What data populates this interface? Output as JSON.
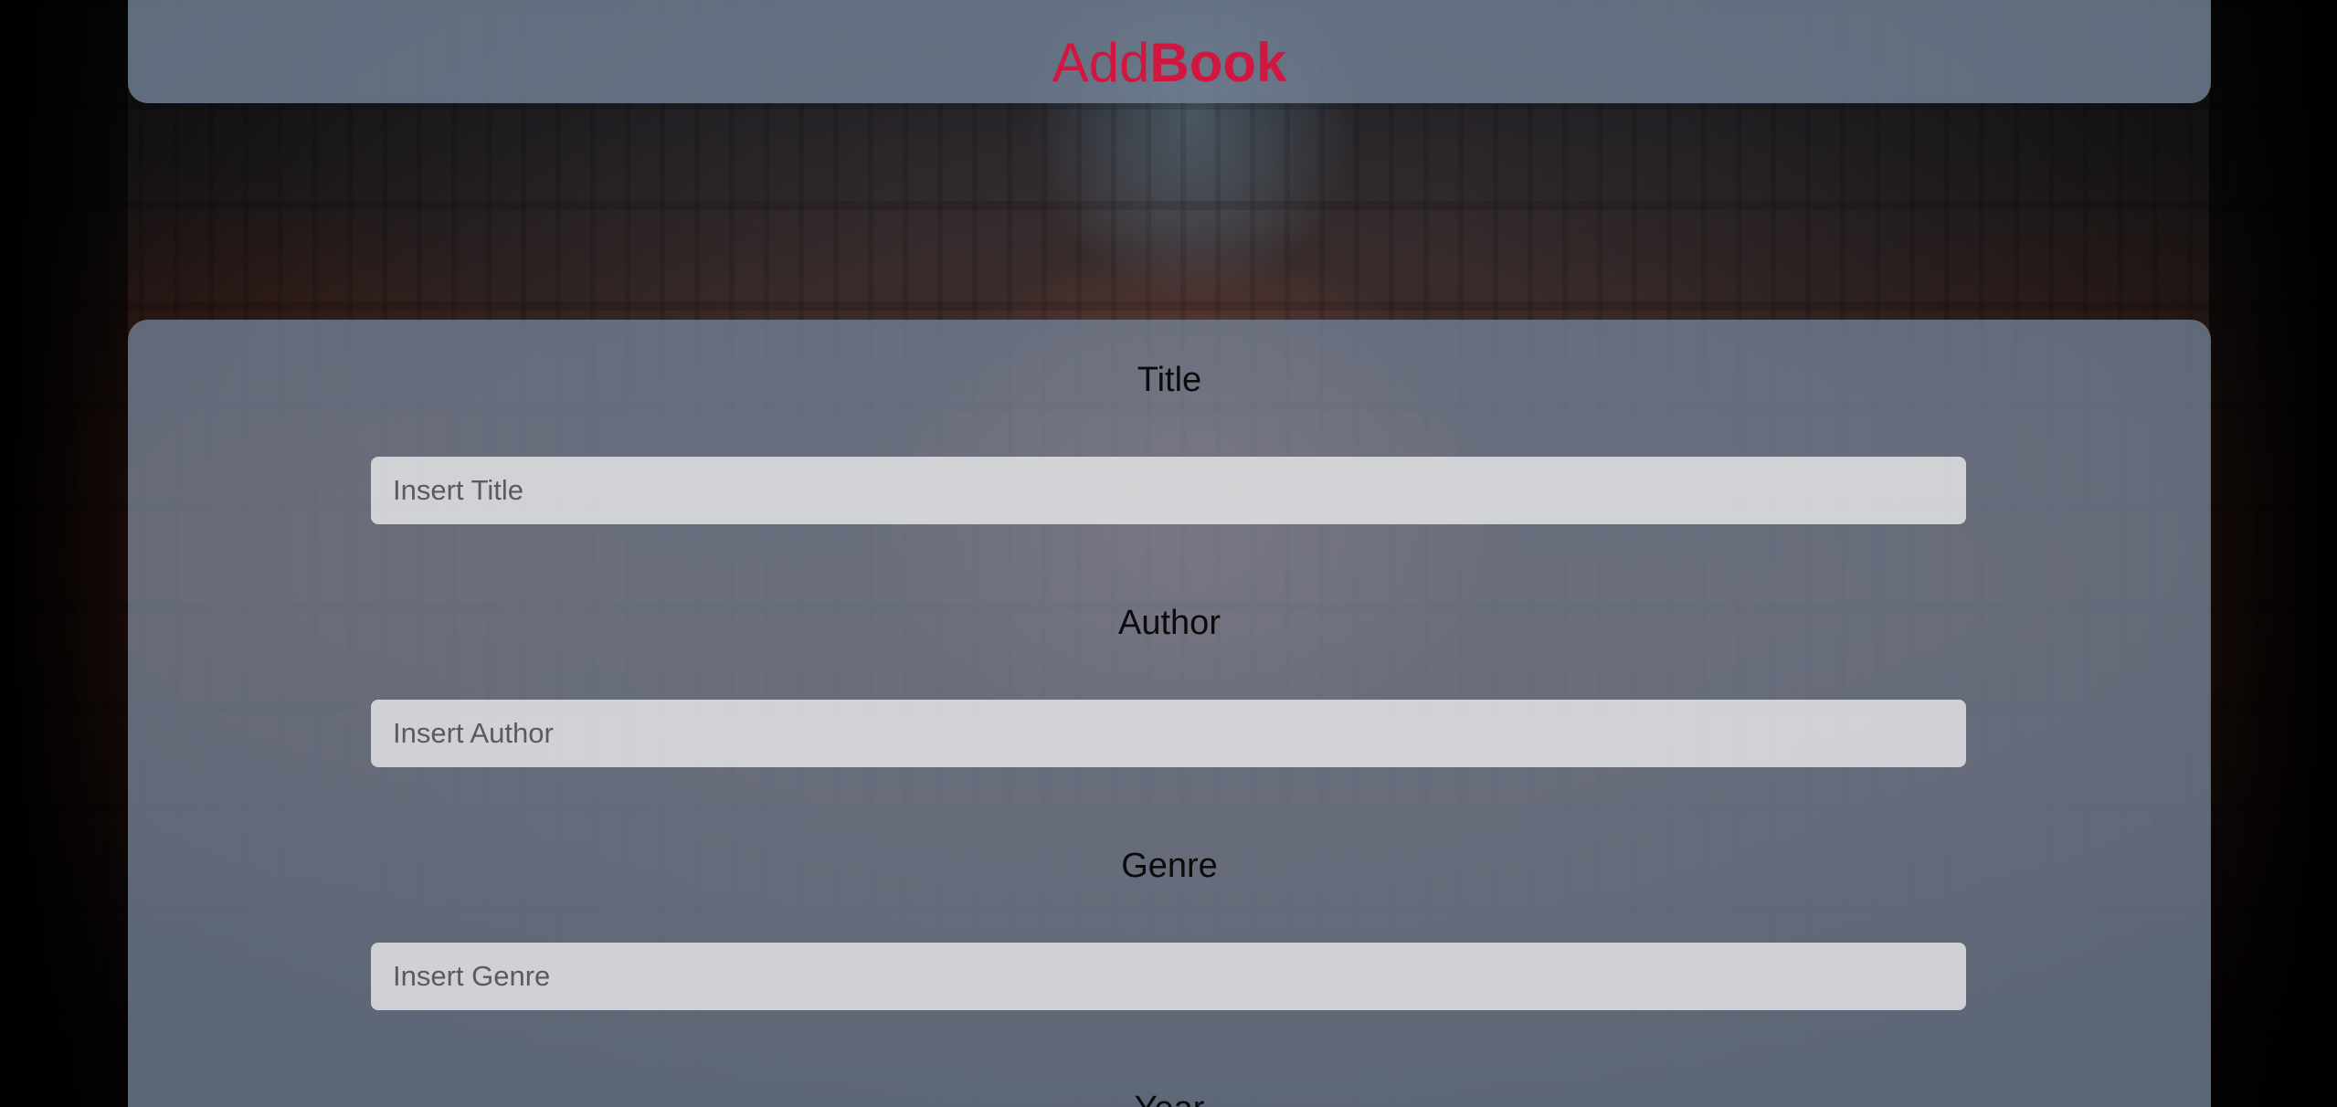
{
  "brand": {
    "part1": "Add",
    "part2": "Book",
    "color": "#d1173f"
  },
  "form": {
    "fields": [
      {
        "label": "Title",
        "placeholder": "Insert Title",
        "value": ""
      },
      {
        "label": "Author",
        "placeholder": "Insert Author",
        "value": ""
      },
      {
        "label": "Genre",
        "placeholder": "Insert Genre",
        "value": ""
      },
      {
        "label": "Year"
      }
    ]
  }
}
